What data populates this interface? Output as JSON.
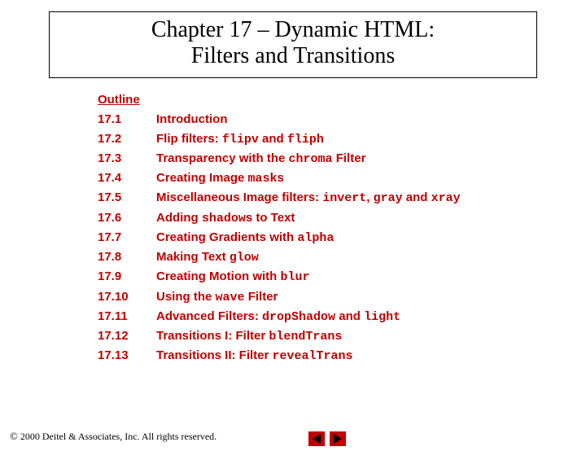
{
  "title": {
    "line1": "Chapter 17 – Dynamic HTML:",
    "line2": "Filters and Transitions"
  },
  "outline_label": "Outline",
  "items": [
    {
      "num": "17.1",
      "parts": [
        {
          "t": "Introduction"
        }
      ]
    },
    {
      "num": "17.2",
      "parts": [
        {
          "t": "Flip filters: "
        },
        {
          "t": "flipv",
          "m": 1
        },
        {
          "t": " and "
        },
        {
          "t": "fliph",
          "m": 1
        }
      ]
    },
    {
      "num": "17.3",
      "parts": [
        {
          "t": "Transparency with the "
        },
        {
          "t": "chroma",
          "m": 1
        },
        {
          "t": " Filter"
        }
      ]
    },
    {
      "num": "17.4",
      "parts": [
        {
          "t": "Creating Image "
        },
        {
          "t": "mask",
          "m": 1
        },
        {
          "t": "s"
        }
      ]
    },
    {
      "num": "17.5",
      "parts": [
        {
          "t": "Miscellaneous Image filters: "
        },
        {
          "t": "invert",
          "m": 1
        },
        {
          "t": ", "
        },
        {
          "t": "gray",
          "m": 1
        },
        {
          "t": " and "
        },
        {
          "t": "xray",
          "m": 1
        }
      ]
    },
    {
      "num": "17.6",
      "parts": [
        {
          "t": "Adding "
        },
        {
          "t": "shadow",
          "m": 1
        },
        {
          "t": "s to Text"
        }
      ]
    },
    {
      "num": "17.7",
      "parts": [
        {
          "t": "Creating Gradients with "
        },
        {
          "t": "alpha",
          "m": 1
        }
      ]
    },
    {
      "num": "17.8",
      "parts": [
        {
          "t": "Making Text "
        },
        {
          "t": "glow",
          "m": 1
        }
      ]
    },
    {
      "num": "17.9",
      "parts": [
        {
          "t": "Creating Motion with "
        },
        {
          "t": "blur",
          "m": 1
        }
      ]
    },
    {
      "num": "17.10",
      "parts": [
        {
          "t": "Using the "
        },
        {
          "t": "wave",
          "m": 1
        },
        {
          "t": " Filter"
        }
      ]
    },
    {
      "num": "17.11",
      "parts": [
        {
          "t": "Advanced Filters: "
        },
        {
          "t": "dropShadow",
          "m": 1
        },
        {
          "t": " and "
        },
        {
          "t": "light",
          "m": 1
        }
      ]
    },
    {
      "num": "17.12",
      "parts": [
        {
          "t": "Transitions I: Filter "
        },
        {
          "t": "blendTrans",
          "m": 1
        }
      ]
    },
    {
      "num": "17.13",
      "parts": [
        {
          "t": "Transitions II: Filter "
        },
        {
          "t": "revealTrans",
          "m": 1
        }
      ]
    }
  ],
  "footer": {
    "copyright": " 2000 Deitel & Associates, Inc.  All rights reserved."
  }
}
